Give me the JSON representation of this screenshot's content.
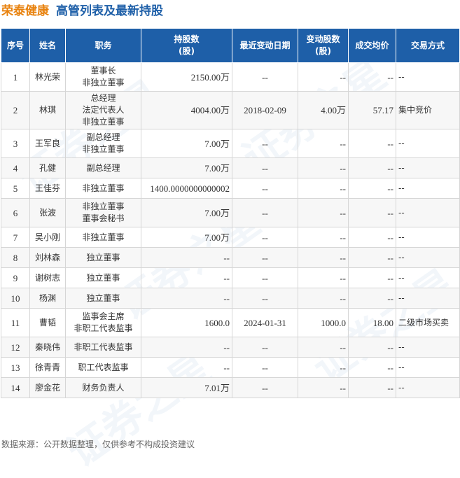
{
  "header": {
    "company": "荣泰健康",
    "subtitle": "高管列表及最新持股"
  },
  "columns": [
    "序号",
    "姓名",
    "职务",
    "持股数\n(股)",
    "最近变动日期",
    "变动股数\n(股)",
    "成交均价",
    "交易方式"
  ],
  "rows": [
    {
      "idx": "1",
      "name": "林光荣",
      "positions": [
        "董事长",
        "非独立董事"
      ],
      "shares": "2150.00万",
      "date": "--",
      "change": "--",
      "price": "--",
      "method": "--"
    },
    {
      "idx": "2",
      "name": "林琪",
      "positions": [
        "总经理",
        "法定代表人",
        "非独立董事"
      ],
      "shares": "4004.00万",
      "date": "2018-02-09",
      "change": "4.00万",
      "price": "57.17",
      "method": "集中竞价"
    },
    {
      "idx": "3",
      "name": "王军良",
      "positions": [
        "副总经理",
        "非独立董事"
      ],
      "shares": "7.00万",
      "date": "--",
      "change": "--",
      "price": "--",
      "method": "--"
    },
    {
      "idx": "4",
      "name": "孔健",
      "positions": [
        "副总经理"
      ],
      "shares": "7.00万",
      "date": "--",
      "change": "--",
      "price": "--",
      "method": "--"
    },
    {
      "idx": "5",
      "name": "王佳芬",
      "positions": [
        "非独立董事"
      ],
      "shares": "1400.0000000000002",
      "date": "--",
      "change": "--",
      "price": "--",
      "method": "--"
    },
    {
      "idx": "6",
      "name": "张波",
      "positions": [
        "非独立董事",
        "董事会秘书"
      ],
      "shares": "7.00万",
      "date": "--",
      "change": "--",
      "price": "--",
      "method": "--"
    },
    {
      "idx": "7",
      "name": "吴小刚",
      "positions": [
        "非独立董事"
      ],
      "shares": "7.00万",
      "date": "--",
      "change": "--",
      "price": "--",
      "method": "--"
    },
    {
      "idx": "8",
      "name": "刘林森",
      "positions": [
        "独立董事"
      ],
      "shares": "--",
      "date": "--",
      "change": "--",
      "price": "--",
      "method": "--"
    },
    {
      "idx": "9",
      "name": "谢树志",
      "positions": [
        "独立董事"
      ],
      "shares": "--",
      "date": "--",
      "change": "--",
      "price": "--",
      "method": "--"
    },
    {
      "idx": "10",
      "name": "杨渊",
      "positions": [
        "独立董事"
      ],
      "shares": "--",
      "date": "--",
      "change": "--",
      "price": "--",
      "method": "--"
    },
    {
      "idx": "11",
      "name": "曹韬",
      "positions": [
        "监事会主席",
        "非职工代表监事"
      ],
      "shares": "1600.0",
      "date": "2024-01-31",
      "change": "1000.0",
      "price": "18.00",
      "method": "二级市场买卖"
    },
    {
      "idx": "12",
      "name": "秦晓伟",
      "positions": [
        "非职工代表监事"
      ],
      "shares": "--",
      "date": "--",
      "change": "--",
      "price": "--",
      "method": "--"
    },
    {
      "idx": "13",
      "name": "徐青青",
      "positions": [
        "职工代表监事"
      ],
      "shares": "--",
      "date": "--",
      "change": "--",
      "price": "--",
      "method": "--"
    },
    {
      "idx": "14",
      "name": "廖金花",
      "positions": [
        "财务负责人"
      ],
      "shares": "7.01万",
      "date": "--",
      "change": "--",
      "price": "--",
      "method": "--"
    }
  ],
  "footer": "数据来源：公开数据整理，仅供参考不构成投资建议",
  "watermark": "证券之星",
  "colors": {
    "company": "#e8820e",
    "subtitle": "#1e5fa8",
    "header_bg": "#1e5fa8",
    "highlight": "#e02020"
  }
}
